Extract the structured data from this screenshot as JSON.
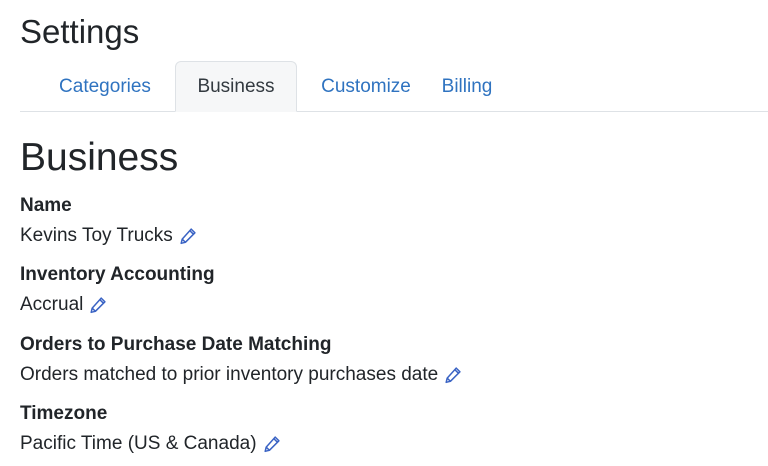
{
  "page": {
    "title": "Settings"
  },
  "tabs": [
    {
      "label": "Categories",
      "active": false
    },
    {
      "label": "Business",
      "active": true
    },
    {
      "label": "Customize",
      "active": false
    },
    {
      "label": "Billing",
      "active": false
    }
  ],
  "section": {
    "title": "Business"
  },
  "fields": [
    {
      "label": "Name",
      "value": "Kevins Toy Trucks"
    },
    {
      "label": "Inventory Accounting",
      "value": "Accrual"
    },
    {
      "label": "Orders to Purchase Date Matching",
      "value": "Orders matched to prior inventory purchases date"
    },
    {
      "label": "Timezone",
      "value": "Pacific Time (US & Canada)"
    }
  ],
  "icons": {
    "edit": "pencil-icon"
  },
  "colors": {
    "link": "#2f73c0",
    "active_tab_bg": "#f6f7f8",
    "border": "#dee2e6",
    "icon": "#3a63c4"
  }
}
